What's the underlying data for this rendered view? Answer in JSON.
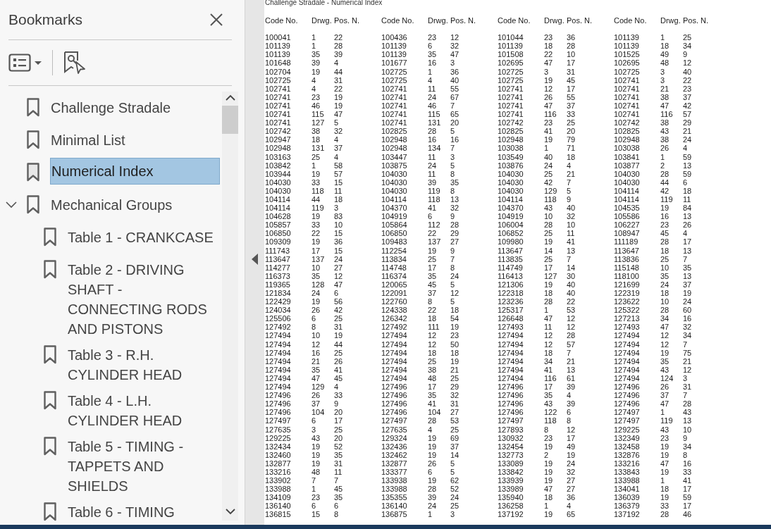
{
  "sidebar": {
    "title": "Bookmarks",
    "items": [
      {
        "label": "Challenge Stradale",
        "selected": false
      },
      {
        "label": "Minimal List",
        "selected": false
      },
      {
        "label": "Numerical Index",
        "selected": true
      },
      {
        "label": "Mechanical Groups",
        "selected": false,
        "expanded": true,
        "children": [
          {
            "label": "Table 1 - CRANKCASE",
            "selected": false
          },
          {
            "label": "Table 2 - DRIVING SHAFT - CONNECTING RODS AND PISTONS",
            "selected": false
          },
          {
            "label": "Table 3 - R.H. CYLINDER HEAD",
            "selected": false
          },
          {
            "label": "Table 4 - L.H. CYLINDER HEAD",
            "selected": false
          },
          {
            "label": "Table 5 - TIMING - TAPPETS AND SHIELDS",
            "selected": false
          },
          {
            "label": "Table 6 - TIMING",
            "selected": false
          }
        ]
      }
    ]
  },
  "document": {
    "header": "Challenge Stradale - Numerical Index",
    "column_groups": [
      {
        "headings": [
          "Code No.",
          "Drwg.",
          "Pos. N."
        ],
        "rows": [
          [
            "100041",
            "1",
            "22"
          ],
          [
            "101139",
            "1",
            "28"
          ],
          [
            "101139",
            "35",
            "39"
          ],
          [
            "101648",
            "39",
            "4"
          ],
          [
            "102704",
            "19",
            "44"
          ],
          [
            "102725",
            "4",
            "31"
          ],
          [
            "102741",
            "4",
            "22"
          ],
          [
            "102741",
            "23",
            "19"
          ],
          [
            "102741",
            "46",
            "19"
          ],
          [
            "102741",
            "115",
            "47"
          ],
          [
            "102741",
            "127",
            "5"
          ],
          [
            "102742",
            "38",
            "32"
          ],
          [
            "102947",
            "18",
            "4"
          ],
          [
            "102948",
            "131",
            "37"
          ],
          [
            "103163",
            "25",
            "4"
          ],
          [
            "103842",
            "1",
            "58"
          ],
          [
            "103944",
            "19",
            "57"
          ],
          [
            "104030",
            "33",
            "15"
          ],
          [
            "104030",
            "118",
            "11"
          ],
          [
            "104114",
            "44",
            "18"
          ],
          [
            "104114",
            "119",
            "3"
          ],
          [
            "104628",
            "19",
            "83"
          ],
          [
            "105857",
            "33",
            "10"
          ],
          [
            "106850",
            "22",
            "15"
          ],
          [
            "109309",
            "19",
            "36"
          ],
          [
            "111743",
            "17",
            "15"
          ],
          [
            "113647",
            "137",
            "24"
          ],
          [
            "114277",
            "10",
            "27"
          ],
          [
            "116373",
            "35",
            "12"
          ],
          [
            "119365",
            "128",
            "47"
          ],
          [
            "121834",
            "24",
            "6"
          ],
          [
            "122429",
            "19",
            "56"
          ],
          [
            "124034",
            "26",
            "42"
          ],
          [
            "125506",
            "6",
            "25"
          ],
          [
            "127492",
            "8",
            "31"
          ],
          [
            "127494",
            "10",
            "19"
          ],
          [
            "127494",
            "12",
            "44"
          ],
          [
            "127494",
            "16",
            "25"
          ],
          [
            "127494",
            "21",
            "26"
          ],
          [
            "127494",
            "35",
            "41"
          ],
          [
            "127494",
            "47",
            "45"
          ],
          [
            "127494",
            "129",
            "4"
          ],
          [
            "127496",
            "26",
            "33"
          ],
          [
            "127496",
            "37",
            "9"
          ],
          [
            "127496",
            "104",
            "20"
          ],
          [
            "127497",
            "6",
            "17"
          ],
          [
            "127635",
            "3",
            "25"
          ],
          [
            "129225",
            "43",
            "20"
          ],
          [
            "132434",
            "19",
            "52"
          ],
          [
            "132460",
            "19",
            "35"
          ],
          [
            "132877",
            "19",
            "31"
          ],
          [
            "133216",
            "48",
            "11"
          ],
          [
            "133902",
            "7",
            "7"
          ],
          [
            "133988",
            "1",
            "45"
          ],
          [
            "134109",
            "23",
            "35"
          ],
          [
            "136140",
            "6",
            "6"
          ],
          [
            "136815",
            "15",
            "8"
          ]
        ]
      },
      {
        "headings": [
          "Code No.",
          "Drwg.",
          "Pos. N."
        ],
        "rows": [
          [
            "100436",
            "23",
            "12"
          ],
          [
            "101139",
            "6",
            "32"
          ],
          [
            "101139",
            "35",
            "47"
          ],
          [
            "101677",
            "16",
            "3"
          ],
          [
            "102725",
            "1",
            "36"
          ],
          [
            "102725",
            "4",
            "40"
          ],
          [
            "102741",
            "11",
            "55"
          ],
          [
            "102741",
            "24",
            "67"
          ],
          [
            "102741",
            "46",
            "7"
          ],
          [
            "102741",
            "115",
            "65"
          ],
          [
            "102741",
            "131",
            "20"
          ],
          [
            "102825",
            "28",
            "5"
          ],
          [
            "102948",
            "16",
            "16"
          ],
          [
            "102948",
            "134",
            "7"
          ],
          [
            "103447",
            "11",
            "3"
          ],
          [
            "103875",
            "24",
            "5"
          ],
          [
            "104030",
            "11",
            "8"
          ],
          [
            "104030",
            "39",
            "35"
          ],
          [
            "104030",
            "119",
            "8"
          ],
          [
            "104114",
            "118",
            "13"
          ],
          [
            "104370",
            "41",
            "32"
          ],
          [
            "104919",
            "6",
            "9"
          ],
          [
            "105864",
            "112",
            "28"
          ],
          [
            "106850",
            "22",
            "29"
          ],
          [
            "109483",
            "137",
            "27"
          ],
          [
            "112254",
            "19",
            "9"
          ],
          [
            "113834",
            "25",
            "7"
          ],
          [
            "114748",
            "17",
            "8"
          ],
          [
            "116374",
            "35",
            "24"
          ],
          [
            "120065",
            "45",
            "5"
          ],
          [
            "122091",
            "37",
            "12"
          ],
          [
            "122760",
            "8",
            "5"
          ],
          [
            "124338",
            "22",
            "18"
          ],
          [
            "126342",
            "18",
            "54"
          ],
          [
            "127492",
            "111",
            "19"
          ],
          [
            "127494",
            "12",
            "23"
          ],
          [
            "127494",
            "12",
            "50"
          ],
          [
            "127494",
            "18",
            "18"
          ],
          [
            "127494",
            "25",
            "19"
          ],
          [
            "127494",
            "38",
            "21"
          ],
          [
            "127494",
            "48",
            "25"
          ],
          [
            "127496",
            "17",
            "29"
          ],
          [
            "127496",
            "35",
            "32"
          ],
          [
            "127496",
            "41",
            "31"
          ],
          [
            "127496",
            "104",
            "27"
          ],
          [
            "127497",
            "28",
            "53"
          ],
          [
            "127635",
            "4",
            "25"
          ],
          [
            "129324",
            "19",
            "69"
          ],
          [
            "132436",
            "19",
            "37"
          ],
          [
            "132462",
            "19",
            "14"
          ],
          [
            "132877",
            "26",
            "5"
          ],
          [
            "133377",
            "6",
            "5"
          ],
          [
            "133938",
            "19",
            "62"
          ],
          [
            "133988",
            "28",
            "52"
          ],
          [
            "135355",
            "39",
            "24"
          ],
          [
            "136140",
            "24",
            "25"
          ],
          [
            "136875",
            "1",
            "3"
          ]
        ]
      },
      {
        "headings": [
          "Code No.",
          "Drwg.",
          "Pos. N."
        ],
        "rows": [
          [
            "101044",
            "23",
            "36"
          ],
          [
            "101139",
            "18",
            "28"
          ],
          [
            "101508",
            "22",
            "10"
          ],
          [
            "102695",
            "47",
            "17"
          ],
          [
            "102725",
            "3",
            "31"
          ],
          [
            "102725",
            "19",
            "45"
          ],
          [
            "102741",
            "12",
            "17"
          ],
          [
            "102741",
            "26",
            "55"
          ],
          [
            "102741",
            "47",
            "37"
          ],
          [
            "102741",
            "116",
            "33"
          ],
          [
            "102742",
            "23",
            "25"
          ],
          [
            "102825",
            "41",
            "20"
          ],
          [
            "102948",
            "19",
            "79"
          ],
          [
            "103038",
            "1",
            "71"
          ],
          [
            "103549",
            "40",
            "18"
          ],
          [
            "103876",
            "24",
            "4"
          ],
          [
            "104030",
            "25",
            "21"
          ],
          [
            "104030",
            "42",
            "7"
          ],
          [
            "104030",
            "129",
            "5"
          ],
          [
            "104114",
            "118",
            "9"
          ],
          [
            "104370",
            "43",
            "40"
          ],
          [
            "104919",
            "10",
            "32"
          ],
          [
            "106004",
            "28",
            "10"
          ],
          [
            "106852",
            "25",
            "11"
          ],
          [
            "109980",
            "19",
            "41"
          ],
          [
            "113647",
            "14",
            "13"
          ],
          [
            "113835",
            "25",
            "7"
          ],
          [
            "114749",
            "17",
            "14"
          ],
          [
            "116413",
            "127",
            "30"
          ],
          [
            "121306",
            "19",
            "40"
          ],
          [
            "122318",
            "18",
            "40"
          ],
          [
            "123236",
            "28",
            "22"
          ],
          [
            "125317",
            "1",
            "53"
          ],
          [
            "126648",
            "47",
            "12"
          ],
          [
            "127493",
            "11",
            "12"
          ],
          [
            "127494",
            "12",
            "28"
          ],
          [
            "127494",
            "12",
            "57"
          ],
          [
            "127494",
            "18",
            "7"
          ],
          [
            "127494",
            "34",
            "21"
          ],
          [
            "127494",
            "41",
            "13"
          ],
          [
            "127494",
            "116",
            "61"
          ],
          [
            "127496",
            "17",
            "39"
          ],
          [
            "127496",
            "35",
            "4"
          ],
          [
            "127496",
            "43",
            "39"
          ],
          [
            "127496",
            "122",
            "6"
          ],
          [
            "127497",
            "118",
            "8"
          ],
          [
            "127893",
            "8",
            "12"
          ],
          [
            "130932",
            "23",
            "17"
          ],
          [
            "132454",
            "19",
            "49"
          ],
          [
            "132773",
            "2",
            "19"
          ],
          [
            "133089",
            "19",
            "24"
          ],
          [
            "133842",
            "19",
            "32"
          ],
          [
            "133939",
            "19",
            "27"
          ],
          [
            "133989",
            "47",
            "27"
          ],
          [
            "135940",
            "18",
            "36"
          ],
          [
            "136258",
            "1",
            "4"
          ],
          [
            "137192",
            "19",
            "65"
          ]
        ]
      },
      {
        "headings": [
          "Code No.",
          "Drwg.",
          "Pos. N."
        ],
        "rows": [
          [
            "101139",
            "1",
            "25"
          ],
          [
            "101139",
            "18",
            "34"
          ],
          [
            "101525",
            "49",
            "9"
          ],
          [
            "102695",
            "48",
            "12"
          ],
          [
            "102725",
            "3",
            "40"
          ],
          [
            "102741",
            "3",
            "22"
          ],
          [
            "102741",
            "21",
            "23"
          ],
          [
            "102741",
            "38",
            "37"
          ],
          [
            "102741",
            "47",
            "42"
          ],
          [
            "102741",
            "116",
            "57"
          ],
          [
            "102742",
            "38",
            "29"
          ],
          [
            "102825",
            "43",
            "21"
          ],
          [
            "102948",
            "38",
            "24"
          ],
          [
            "103038",
            "26",
            "4"
          ],
          [
            "103841",
            "1",
            "59"
          ],
          [
            "103877",
            "2",
            "13"
          ],
          [
            "104030",
            "28",
            "59"
          ],
          [
            "104030",
            "44",
            "6"
          ],
          [
            "104114",
            "42",
            "18"
          ],
          [
            "104114",
            "119",
            "11"
          ],
          [
            "104535",
            "19",
            "84"
          ],
          [
            "105586",
            "16",
            "13"
          ],
          [
            "106227",
            "23",
            "26"
          ],
          [
            "108947",
            "45",
            "4"
          ],
          [
            "111189",
            "28",
            "17"
          ],
          [
            "113647",
            "18",
            "13"
          ],
          [
            "113836",
            "25",
            "7"
          ],
          [
            "115148",
            "10",
            "35"
          ],
          [
            "118100",
            "35",
            "13"
          ],
          [
            "121699",
            "24",
            "37"
          ],
          [
            "122319",
            "18",
            "19"
          ],
          [
            "123622",
            "10",
            "24"
          ],
          [
            "125322",
            "28",
            "60"
          ],
          [
            "127213",
            "34",
            "16"
          ],
          [
            "127493",
            "47",
            "32"
          ],
          [
            "127494",
            "12",
            "34"
          ],
          [
            "127494",
            "12",
            "7"
          ],
          [
            "127494",
            "19",
            "75"
          ],
          [
            "127494",
            "35",
            "21"
          ],
          [
            "127494",
            "43",
            "12"
          ],
          [
            "127494",
            "124",
            "3"
          ],
          [
            "127496",
            "26",
            "31"
          ],
          [
            "127496",
            "37",
            "7"
          ],
          [
            "127496",
            "47",
            "28"
          ],
          [
            "127497",
            "1",
            "43"
          ],
          [
            "127497",
            "119",
            "13"
          ],
          [
            "129225",
            "43",
            "10"
          ],
          [
            "132349",
            "23",
            "9"
          ],
          [
            "132458",
            "19",
            "34"
          ],
          [
            "132876",
            "19",
            "8"
          ],
          [
            "133216",
            "47",
            "16"
          ],
          [
            "133843",
            "19",
            "33"
          ],
          [
            "133988",
            "1",
            "41"
          ],
          [
            "134041",
            "18",
            "17"
          ],
          [
            "136039",
            "19",
            "59"
          ],
          [
            "136379",
            "33",
            "17"
          ],
          [
            "137192",
            "28",
            "46"
          ]
        ]
      }
    ]
  }
}
